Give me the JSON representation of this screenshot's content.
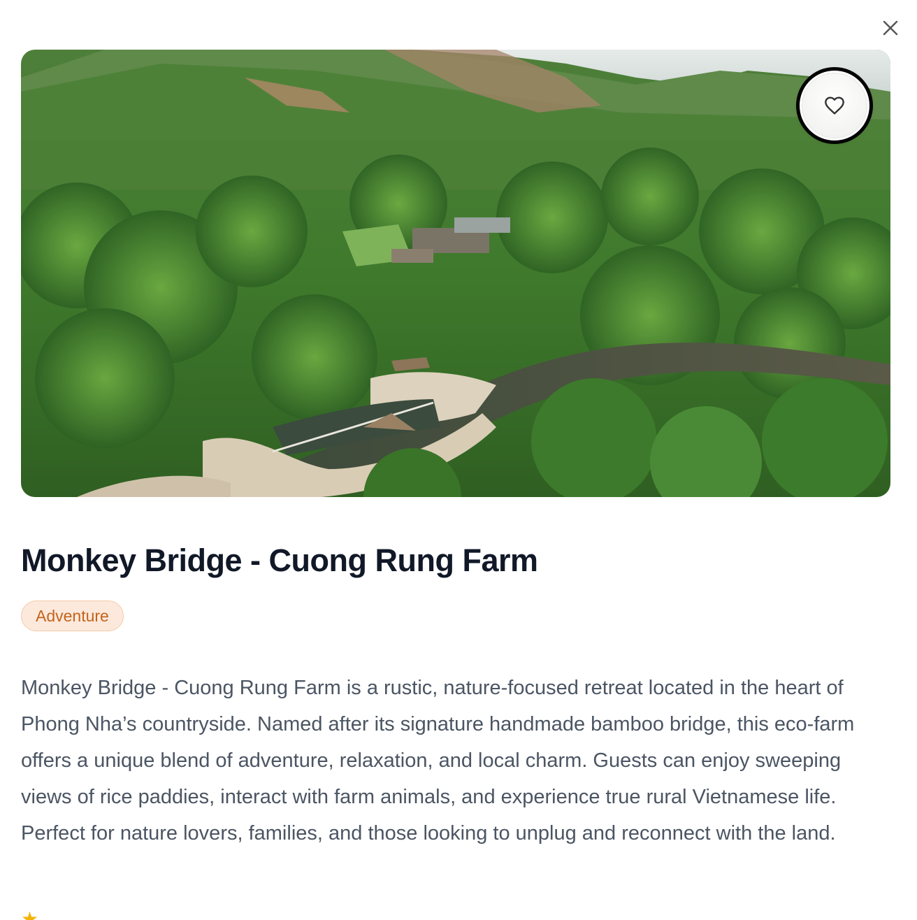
{
  "modal": {
    "close_label": "",
    "title": "Monkey Bridge - Cuong Rung Farm",
    "tag": "Adventure",
    "description": "Monkey Bridge - Cuong Rung Farm is a rustic, nature-focused retreat located in the heart of Phong Nha’s countryside. Named after its signature handmade bamboo bridge, this eco-farm offers a unique blend of adventure, relaxation, and local charm. Guests can enjoy sweeping views of rice paddies, interact with farm animals, and experience true rural Vietnamese life. Perfect for nature lovers, families, and those looking to unplug and reconnect with the land.",
    "rating_icon": "star-icon",
    "favorite_icon": "heart-icon"
  },
  "colors": {
    "title": "#111827",
    "tag_bg": "#fde9dc",
    "tag_text": "#c2641c",
    "body_text": "#4b5563"
  }
}
